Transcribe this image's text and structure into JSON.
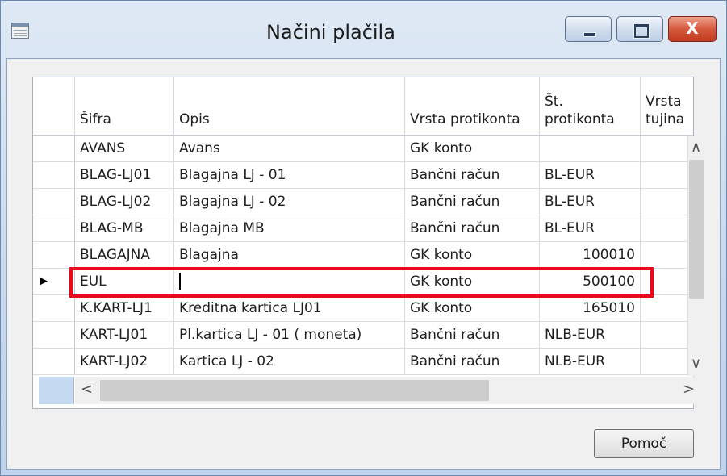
{
  "window": {
    "title": "Načini plačila",
    "icon": "table-window-icon",
    "controls": {
      "minimize": "minimize-icon",
      "maximize": "maximize-icon",
      "close": "close-icon",
      "close_glyph": "X"
    }
  },
  "table": {
    "columns": [
      "Šifra",
      "Opis",
      "Vrsta protikonta",
      "Št.\nprotikonta",
      "Vrsta\ntujina"
    ],
    "rows": [
      {
        "sifra": "AVANS",
        "opis": "Avans",
        "vrsta": "GK konto",
        "st": "",
        "numeric": false
      },
      {
        "sifra": "BLAG-LJ01",
        "opis": "Blagajna LJ - 01",
        "vrsta": "Bančni račun",
        "st": "BL-EUR",
        "numeric": false
      },
      {
        "sifra": "BLAG-LJ02",
        "opis": "Blagajna LJ - 02",
        "vrsta": "Bančni račun",
        "st": "BL-EUR",
        "numeric": false
      },
      {
        "sifra": "BLAG-MB",
        "opis": "Blagajna MB",
        "vrsta": "Bančni račun",
        "st": "BL-EUR",
        "numeric": false
      },
      {
        "sifra": "BLAGAJNA",
        "opis": "Blagajna",
        "vrsta": "GK konto",
        "st": "100010",
        "numeric": true
      },
      {
        "sifra": "EUL",
        "opis": "",
        "vrsta": "GK konto",
        "st": "500100",
        "numeric": true
      },
      {
        "sifra": "K.KART-LJ1",
        "opis": "Kreditna kartica LJ01",
        "vrsta": "GK konto",
        "st": "165010",
        "numeric": true
      },
      {
        "sifra": "KART-LJ01",
        "opis": "Pl.kartica LJ - 01 ( moneta)",
        "vrsta": "Bančni račun",
        "st": "NLB-EUR",
        "numeric": false
      },
      {
        "sifra": "KART-LJ02",
        "opis": "Kartica LJ - 02",
        "vrsta": "Bančni račun",
        "st": "NLB-EUR",
        "numeric": false
      }
    ],
    "current_row": 5,
    "current_row_marker": "▶"
  },
  "scroll": {
    "up": "▲",
    "down": "▼",
    "left": "<",
    "right": ">"
  },
  "buttons": {
    "help": "Pomoč"
  },
  "colors": {
    "highlight": "#e8091b",
    "accent": "#c5daf0"
  }
}
